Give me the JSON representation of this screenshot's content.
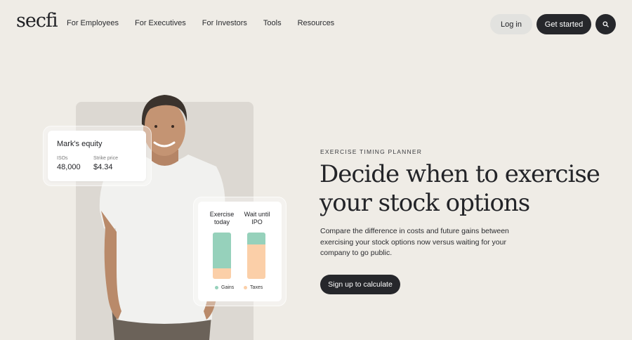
{
  "nav": {
    "logo": "secfi",
    "links": [
      "For Employees",
      "For Executives",
      "For Investors",
      "Tools",
      "Resources"
    ],
    "login_label": "Log in",
    "get_started_label": "Get started"
  },
  "equity_card": {
    "title": "Mark's equity",
    "isos_label": "ISOs",
    "isos_value": "48,000",
    "strike_label": "Strike price",
    "strike_value": "$4.34"
  },
  "compare_card": {
    "col1_label": "Exercise today",
    "col2_label": "Wait until IPO",
    "col1_gains_fraction": 0.78,
    "col2_gains_fraction": 0.25,
    "legend_gains": "Gains",
    "legend_taxes": "Taxes",
    "colors": {
      "gains": "#96d1bb",
      "taxes": "#fbcfa8"
    }
  },
  "hero": {
    "eyebrow": "EXERCISE TIMING PLANNER",
    "headline": "Decide when to exercise your stock options",
    "description": "Compare the difference in costs and future gains between exercising your stock options now versus waiting for your company to go public.",
    "cta_label": "Sign up to calculate"
  },
  "colors": {
    "background": "#efece6",
    "dark_button": "#26272b",
    "light_button": "#e2e2df"
  }
}
